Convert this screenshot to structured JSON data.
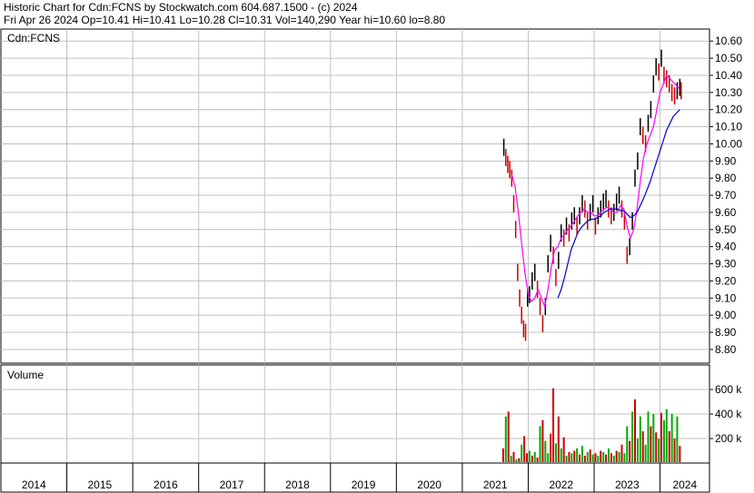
{
  "header": {
    "line1": "Historic Chart for Cdn:FCNS by Stockwatch.com 604.687.1500 - (c) 2024",
    "line2": "Fri Apr 26 2024   Op=10.41   Hi=10.41   Lo=10.28   Cl=10.31   Vol=140,290   Year hi=10.60   lo=8.80"
  },
  "chart_data": [
    {
      "type": "line",
      "title": "",
      "panel_label": "Cdn:FCNS",
      "ylim": [
        8.72,
        10.67
      ],
      "y_ticks": [
        "10.60",
        "10.50",
        "10.40",
        "10.30",
        "10.20",
        "10.10",
        "10.00",
        "9.90",
        "9.80",
        "9.70",
        "9.60",
        "9.50",
        "9.40",
        "9.30",
        "9.20",
        "9.10",
        "9.00",
        "8.90",
        "8.80"
      ],
      "x_ticks": [
        "2014",
        "2015",
        "2016",
        "2017",
        "2018",
        "2019",
        "2020",
        "2021",
        "2022",
        "2023",
        "2024"
      ],
      "grid": true,
      "colors": {
        "price_up": "#000000",
        "price_down": "#cc0000",
        "ma_short": "#ff00ff",
        "ma_long": "#0000cc",
        "grid": "#c0c0c0"
      },
      "series": [
        {
          "kind": "price",
          "x": [
            2021.63,
            2021.66,
            2021.69,
            2021.72,
            2021.75,
            2021.78,
            2021.81,
            2021.84,
            2021.87,
            2021.9,
            2021.93,
            2021.96,
            2021.99,
            2022.02,
            2022.06,
            2022.1,
            2022.14,
            2022.18,
            2022.22,
            2022.26,
            2022.3,
            2022.34,
            2022.38,
            2022.42,
            2022.46,
            2022.5,
            2022.54,
            2022.58,
            2022.62,
            2022.66,
            2022.7,
            2022.74,
            2022.78,
            2022.82,
            2022.86,
            2022.9,
            2022.94,
            2022.98,
            2023.02,
            2023.06,
            2023.1,
            2023.14,
            2023.18,
            2023.22,
            2023.26,
            2023.3,
            2023.34,
            2023.38,
            2023.42,
            2023.46,
            2023.5,
            2023.54,
            2023.58,
            2023.62,
            2023.66,
            2023.7,
            2023.74,
            2023.78,
            2023.82,
            2023.86,
            2023.9,
            2023.94,
            2023.98,
            2024.02,
            2024.06,
            2024.1,
            2024.14,
            2024.18,
            2024.22,
            2024.26,
            2024.3,
            2024.32
          ],
          "values": [
            9.98,
            9.92,
            9.88,
            9.85,
            9.8,
            9.65,
            9.5,
            9.25,
            9.1,
            9.0,
            8.92,
            8.9,
            9.1,
            9.12,
            9.2,
            9.25,
            9.15,
            9.05,
            8.95,
            9.05,
            9.3,
            9.42,
            9.35,
            9.22,
            9.32,
            9.48,
            9.45,
            9.52,
            9.48,
            9.55,
            9.58,
            9.52,
            9.58,
            9.65,
            9.62,
            9.55,
            9.6,
            9.65,
            9.52,
            9.58,
            9.62,
            9.66,
            9.68,
            9.62,
            9.58,
            9.6,
            9.66,
            9.7,
            9.62,
            9.55,
            9.35,
            9.4,
            9.55,
            9.8,
            9.9,
            10.1,
            10.05,
            10.0,
            10.12,
            10.2,
            10.35,
            10.45,
            10.42,
            10.5,
            10.4,
            10.38,
            10.35,
            10.3,
            10.28,
            10.31,
            10.33,
            10.31
          ]
        },
        {
          "kind": "moving_average",
          "name": "",
          "color": "#ff00ff",
          "x": [
            2021.75,
            2021.8,
            2021.85,
            2021.9,
            2021.95,
            2022.0,
            2022.05,
            2022.1,
            2022.15,
            2022.2,
            2022.25,
            2022.3,
            2022.35,
            2022.4,
            2022.45,
            2022.5,
            2022.55,
            2022.6,
            2022.65,
            2022.7,
            2022.75,
            2022.8,
            2022.85,
            2022.9,
            2022.95,
            2023.0,
            2023.05,
            2023.1,
            2023.15,
            2023.2,
            2023.25,
            2023.3,
            2023.35,
            2023.4,
            2023.45,
            2023.5,
            2023.55,
            2023.6,
            2023.65,
            2023.7,
            2023.75,
            2023.8,
            2023.85,
            2023.9,
            2023.95,
            2024.0,
            2024.05,
            2024.1,
            2024.15,
            2024.2,
            2024.25,
            2024.3
          ],
          "values": [
            9.82,
            9.75,
            9.6,
            9.42,
            9.25,
            9.12,
            9.08,
            9.1,
            9.15,
            9.1,
            9.05,
            9.15,
            9.28,
            9.38,
            9.4,
            9.45,
            9.47,
            9.5,
            9.52,
            9.55,
            9.58,
            9.6,
            9.62,
            9.6,
            9.6,
            9.58,
            9.58,
            9.6,
            9.62,
            9.63,
            9.62,
            9.6,
            9.6,
            9.64,
            9.62,
            9.52,
            9.45,
            9.5,
            9.62,
            9.78,
            9.92,
            10.0,
            10.05,
            10.1,
            10.2,
            10.3,
            10.35,
            10.4,
            10.38,
            10.36,
            10.34,
            10.32
          ]
        },
        {
          "kind": "moving_average",
          "name": "",
          "color": "#0000cc",
          "x": [
            2022.45,
            2022.5,
            2022.55,
            2022.6,
            2022.65,
            2022.7,
            2022.75,
            2022.8,
            2022.85,
            2022.9,
            2022.95,
            2023.0,
            2023.05,
            2023.1,
            2023.15,
            2023.2,
            2023.25,
            2023.3,
            2023.35,
            2023.4,
            2023.45,
            2023.5,
            2023.55,
            2023.6,
            2023.65,
            2023.7,
            2023.75,
            2023.8,
            2023.85,
            2023.9,
            2023.95,
            2024.0,
            2024.05,
            2024.1,
            2024.15,
            2024.2,
            2024.25,
            2024.3
          ],
          "values": [
            9.1,
            9.15,
            9.22,
            9.3,
            9.38,
            9.43,
            9.48,
            9.51,
            9.53,
            9.55,
            9.56,
            9.56,
            9.57,
            9.58,
            9.6,
            9.61,
            9.62,
            9.62,
            9.62,
            9.61,
            9.61,
            9.59,
            9.57,
            9.58,
            9.6,
            9.64,
            9.68,
            9.73,
            9.78,
            9.84,
            9.9,
            9.96,
            10.02,
            10.08,
            10.12,
            10.16,
            10.18,
            10.2
          ]
        }
      ]
    },
    {
      "type": "bar",
      "title": "",
      "panel_label": "Volume",
      "ylim": [
        0,
        800000
      ],
      "y_ticks": [
        "600 k",
        "400 k",
        "200 k"
      ],
      "y_tick_values": [
        600000,
        400000,
        200000
      ],
      "colors": {
        "up": "#00aa00",
        "down": "#cc0000"
      },
      "x": [
        2021.62,
        2021.66,
        2021.7,
        2021.74,
        2021.78,
        2021.82,
        2021.86,
        2021.9,
        2021.94,
        2021.98,
        2022.02,
        2022.06,
        2022.1,
        2022.14,
        2022.18,
        2022.22,
        2022.26,
        2022.3,
        2022.34,
        2022.38,
        2022.42,
        2022.46,
        2022.5,
        2022.54,
        2022.58,
        2022.62,
        2022.66,
        2022.7,
        2022.74,
        2022.78,
        2022.82,
        2022.86,
        2022.9,
        2022.94,
        2022.98,
        2023.02,
        2023.06,
        2023.1,
        2023.14,
        2023.18,
        2023.22,
        2023.26,
        2023.3,
        2023.34,
        2023.38,
        2023.42,
        2023.46,
        2023.5,
        2023.54,
        2023.58,
        2023.62,
        2023.66,
        2023.7,
        2023.74,
        2023.78,
        2023.82,
        2023.86,
        2023.9,
        2023.94,
        2023.98,
        2024.02,
        2024.06,
        2024.1,
        2024.14,
        2024.18,
        2024.22,
        2024.26,
        2024.3
      ],
      "values": [
        120000,
        380000,
        420000,
        60000,
        90000,
        30000,
        40000,
        150000,
        220000,
        80000,
        100000,
        60000,
        90000,
        45000,
        300000,
        350000,
        180000,
        80000,
        240000,
        610000,
        160000,
        380000,
        120000,
        210000,
        60000,
        90000,
        80000,
        100000,
        120000,
        70000,
        140000,
        60000,
        90000,
        110000,
        70000,
        80000,
        60000,
        100000,
        90000,
        70000,
        120000,
        80000,
        60000,
        100000,
        90000,
        150000,
        80000,
        300000,
        180000,
        420000,
        520000,
        200000,
        380000,
        260000,
        150000,
        420000,
        300000,
        400000,
        250000,
        200000,
        410000,
        350000,
        440000,
        260000,
        400000,
        200000,
        380000,
        140000
      ],
      "up": [
        false,
        true,
        false,
        true,
        false,
        true,
        false,
        true,
        false,
        false,
        true,
        false,
        true,
        false,
        true,
        false,
        true,
        true,
        false,
        false,
        true,
        false,
        true,
        false,
        true,
        false,
        true,
        false,
        true,
        false,
        true,
        false,
        true,
        false,
        true,
        false,
        true,
        false,
        true,
        false,
        true,
        false,
        true,
        false,
        true,
        false,
        true,
        true,
        false,
        true,
        false,
        true,
        true,
        false,
        true,
        true,
        false,
        true,
        false,
        true,
        false,
        true,
        true,
        false,
        true,
        false,
        true,
        false
      ]
    }
  ]
}
